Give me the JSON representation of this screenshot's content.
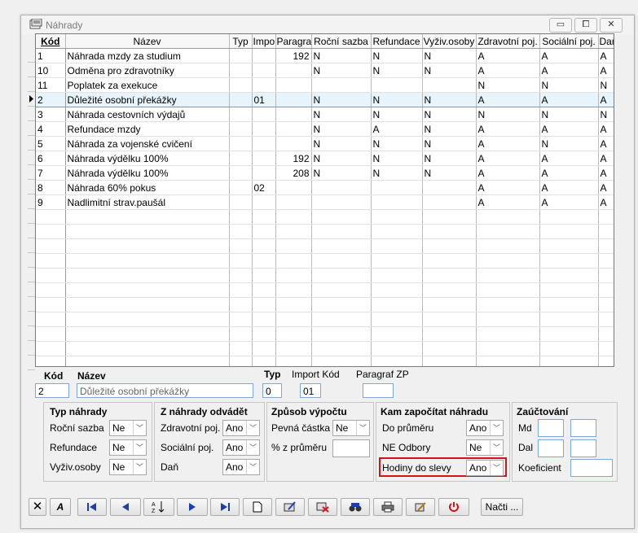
{
  "window": {
    "title": "Náhrady",
    "min": "▭",
    "restore": "⧠",
    "close": "✕"
  },
  "grid": {
    "headers": [
      "Kód",
      "Název",
      "Typ",
      "Impo",
      "Paragra",
      "Roční sazba",
      "Refundace",
      "Vyživ.osoby",
      "Zdravotní poj.",
      "Sociální poj.",
      "Daň"
    ],
    "rows": [
      [
        "1",
        "Náhrada mzdy za studium",
        "",
        "",
        "192",
        "N",
        "N",
        "N",
        "A",
        "A",
        "A"
      ],
      [
        "10",
        "Odměna pro zdravotníky",
        "",
        "",
        "",
        "N",
        "N",
        "N",
        "A",
        "A",
        "A"
      ],
      [
        "11",
        "Poplatek za exekuce",
        "",
        "",
        "",
        "",
        "",
        "",
        "N",
        "N",
        "N"
      ],
      [
        "2",
        "Důležité osobní překážky",
        "",
        "01",
        "",
        "N",
        "N",
        "N",
        "A",
        "A",
        "A"
      ],
      [
        "3",
        "Náhrada cestovních výdajů",
        "",
        "",
        "",
        "N",
        "N",
        "N",
        "N",
        "N",
        "N"
      ],
      [
        "4",
        "Refundace mzdy",
        "",
        "",
        "",
        "N",
        "A",
        "N",
        "A",
        "A",
        "A"
      ],
      [
        "5",
        "Náhrada za vojenské cvičení",
        "",
        "",
        "",
        "N",
        "N",
        "N",
        "A",
        "N",
        "A"
      ],
      [
        "6",
        "Náhrada výdělku 100%",
        "",
        "",
        "192",
        "N",
        "N",
        "N",
        "A",
        "A",
        "A"
      ],
      [
        "7",
        "Náhrada výdělku 100%",
        "",
        "",
        "208",
        "N",
        "N",
        "N",
        "A",
        "A",
        "A"
      ],
      [
        "8",
        "Náhrada 60% pokus",
        "",
        "02",
        "",
        "",
        "",
        "",
        "A",
        "A",
        "A"
      ],
      [
        "9",
        "Nadlimitní strav.paušál",
        "",
        "",
        "",
        "",
        "",
        "",
        "A",
        "A",
        "A"
      ]
    ],
    "selected_index": 3
  },
  "detail": {
    "kod_label": "Kód",
    "kod_value": "2",
    "nazev_label": "Název",
    "nazev_value": "Důležité osobní překážky",
    "typ_label": "Typ",
    "typ_value": "0",
    "import_label": "Import Kód",
    "import_value": "01",
    "paragraf_label": "Paragraf ZP",
    "paragraf_value": ""
  },
  "typ_nahrady": {
    "title": "Typ náhrady",
    "rows": [
      {
        "label": "Roční sazba",
        "value": "Ne"
      },
      {
        "label": "Refundace",
        "value": "Ne"
      },
      {
        "label": "Vyživ.osoby",
        "value": "Ne"
      }
    ]
  },
  "odvadet": {
    "title": "Z náhrady odvádět",
    "rows": [
      {
        "label": "Zdravotní poj.",
        "value": "Ano"
      },
      {
        "label": "Sociální poj.",
        "value": "Ano"
      },
      {
        "label": "Daň",
        "value": "Ano"
      }
    ]
  },
  "zpusob": {
    "title": "Způsob výpočtu",
    "pevna_label": "Pevná částka",
    "pevna_value": "Ne",
    "procent_label": "% z průměru",
    "procent_value": ""
  },
  "kam": {
    "title": "Kam započítat náhradu",
    "rows": [
      {
        "label": "Do průměru",
        "value": "Ano"
      },
      {
        "label": "NE Odbory",
        "value": "Ne"
      },
      {
        "label": "Hodiny do slevy",
        "value": "Ano"
      }
    ],
    "highlight_color": "#d0141c"
  },
  "zauctovani": {
    "title": "Zaúčtování",
    "md_label": "Md",
    "dal_label": "Dal",
    "koef_label": "Koeficient"
  },
  "toolbar": {
    "nacti_label": "Načti ...",
    "az_label": "A↓Z",
    "first": "first-icon",
    "prev": "prev-icon",
    "next": "next-icon",
    "last": "last-icon"
  }
}
